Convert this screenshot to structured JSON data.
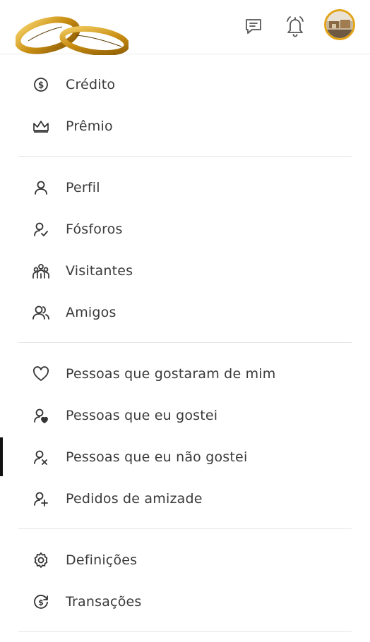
{
  "header": {
    "logo_icon": "wedding-rings-logo",
    "chat_icon": "chat-icon",
    "bell_icon": "bell-icon",
    "avatar_ring_color": "#e2a418"
  },
  "menu": {
    "group1": [
      {
        "label": "Crédito",
        "icon": "coin-icon"
      },
      {
        "label": "Prêmio",
        "icon": "crown-icon"
      }
    ],
    "group2": [
      {
        "label": "Perfil",
        "icon": "user-icon"
      },
      {
        "label": "Fósforos",
        "icon": "user-check-icon"
      },
      {
        "label": "Visitantes",
        "icon": "visitors-icon"
      },
      {
        "label": "Amigos",
        "icon": "friends-icon"
      }
    ],
    "group3": [
      {
        "label": "Pessoas que gostaram de mim",
        "icon": "heart-icon"
      },
      {
        "label": "Pessoas que eu gostei",
        "icon": "user-heart-icon"
      },
      {
        "label": "Pessoas que eu não gostei",
        "icon": "user-x-icon",
        "active": true
      },
      {
        "label": "Pedidos de amizade",
        "icon": "user-plus-icon"
      }
    ],
    "group4": [
      {
        "label": "Definições",
        "icon": "gear-icon"
      },
      {
        "label": "Transações",
        "icon": "transaction-icon"
      }
    ]
  }
}
